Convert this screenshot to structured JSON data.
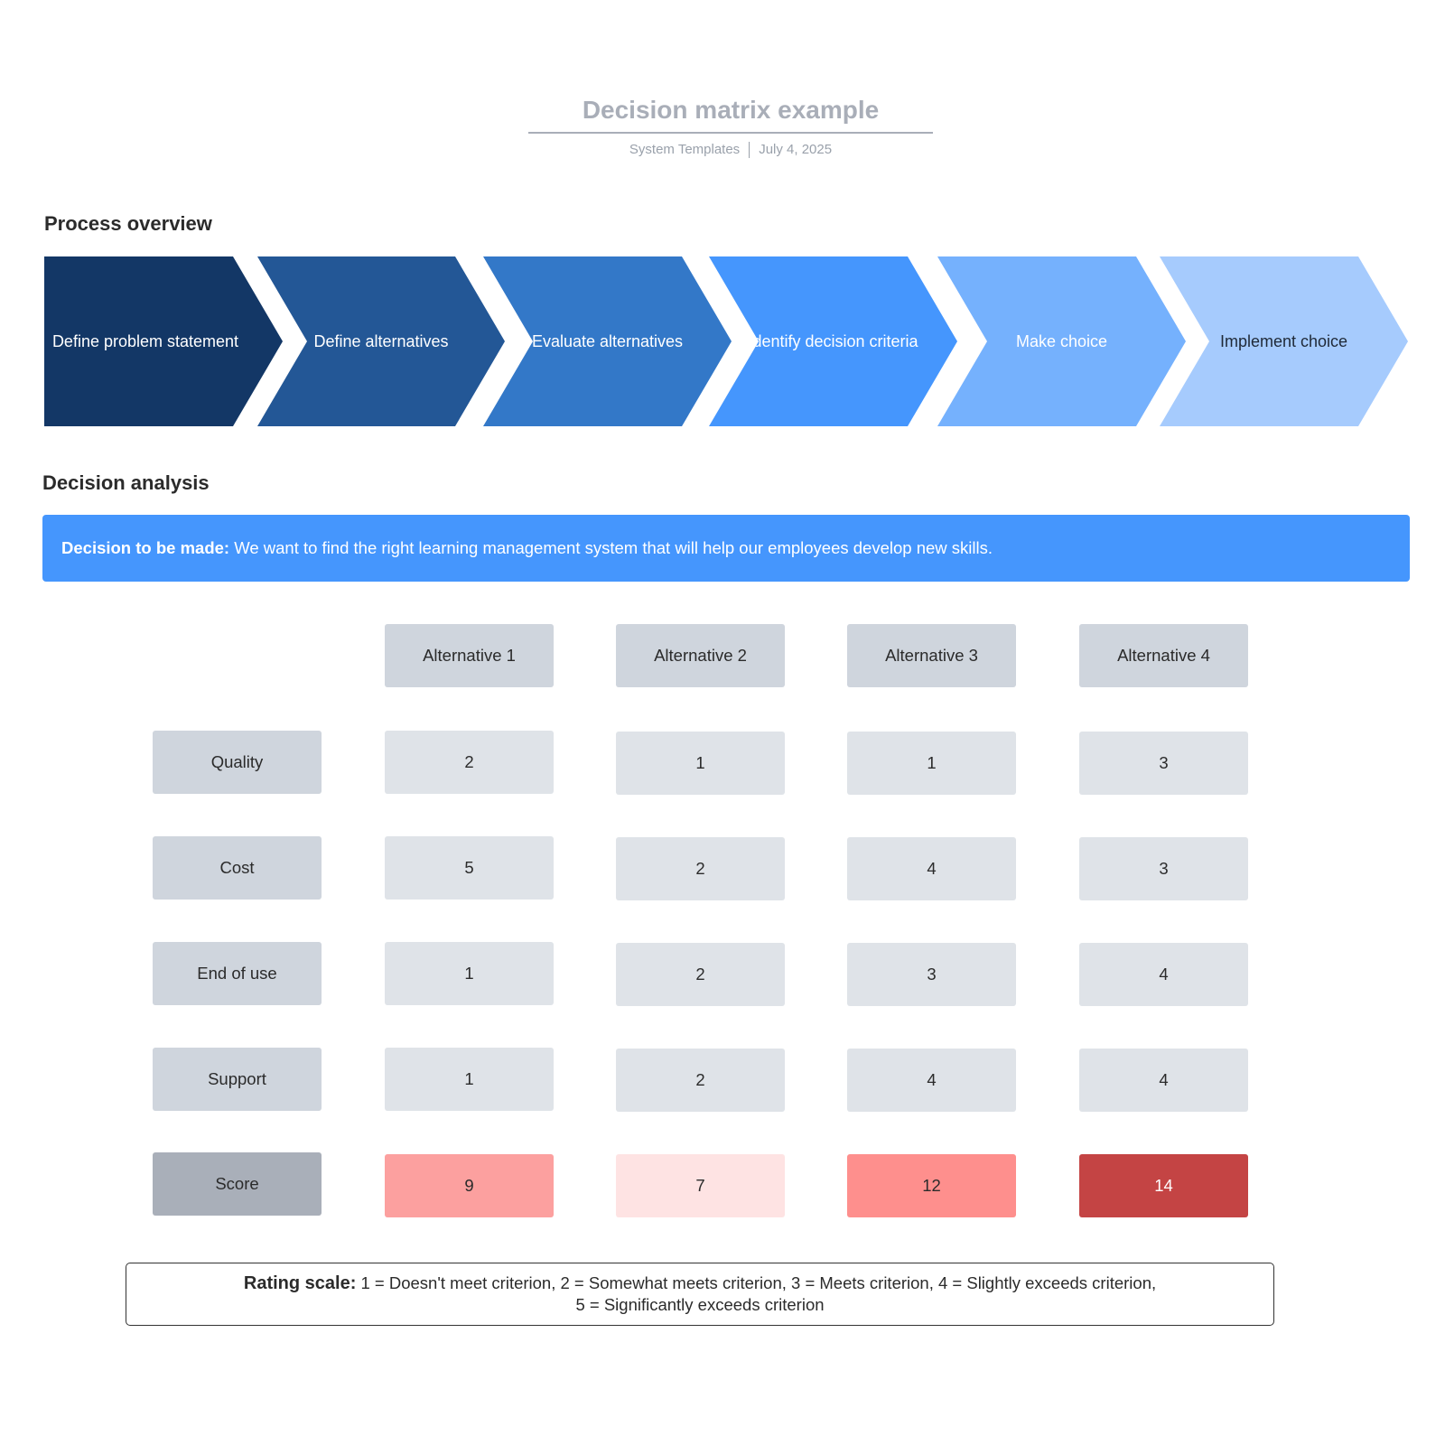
{
  "header": {
    "title": "Decision matrix example",
    "author": "System Templates",
    "date": "July 4, 2025"
  },
  "process": {
    "heading": "Process overview",
    "steps": [
      {
        "label": "Define problem statement",
        "color": "#133766",
        "text_color": "#ffffff"
      },
      {
        "label": "Define alternatives",
        "color": "#235796",
        "text_color": "#ffffff"
      },
      {
        "label": "Evaluate alternatives",
        "color": "#3378c8",
        "text_color": "#ffffff"
      },
      {
        "label": "Identify decision criteria",
        "color": "#4596fd",
        "text_color": "#ffffff"
      },
      {
        "label": "Make choice",
        "color": "#75b1fd",
        "text_color": "#ffffff"
      },
      {
        "label": "Implement choice",
        "color": "#a6cbfd",
        "text_color": "#1f2937"
      }
    ]
  },
  "analysis": {
    "heading": "Decision analysis",
    "decision_label": "Decision to be made",
    "decision_text": " We want to find the right learning management system that will help our employees develop new skills.",
    "alternatives": [
      "Alternative 1",
      "Alternative 2",
      "Alternative 3",
      "Alternative 4"
    ],
    "rows": [
      {
        "criterion": "Quality",
        "values": [
          "2",
          "1",
          "1",
          "3"
        ]
      },
      {
        "criterion": "Cost",
        "values": [
          "5",
          "2",
          "4",
          "3"
        ]
      },
      {
        "criterion": "End of use",
        "values": [
          "1",
          "2",
          "3",
          "4"
        ]
      },
      {
        "criterion": "Support",
        "values": [
          "1",
          "2",
          "4",
          "4"
        ]
      }
    ],
    "score": {
      "label": "Score",
      "values": [
        "9",
        "7",
        "12",
        "14"
      ],
      "colors": [
        "#fca09f",
        "#fee3e3",
        "#fe8f8d",
        "#c44444"
      ],
      "text_colors": [
        "#2b2b2b",
        "#2b2b2b",
        "#2b2b2b",
        "#ffffff"
      ]
    },
    "rating_label": "Rating scale:",
    "rating_line1": " 1 = Doesn't meet criterion, 2 = Somewhat meets criterion, 3 = Meets criterion, 4 = Slightly exceeds criterion,",
    "rating_line2": "5 = Significantly exceeds criterion"
  }
}
